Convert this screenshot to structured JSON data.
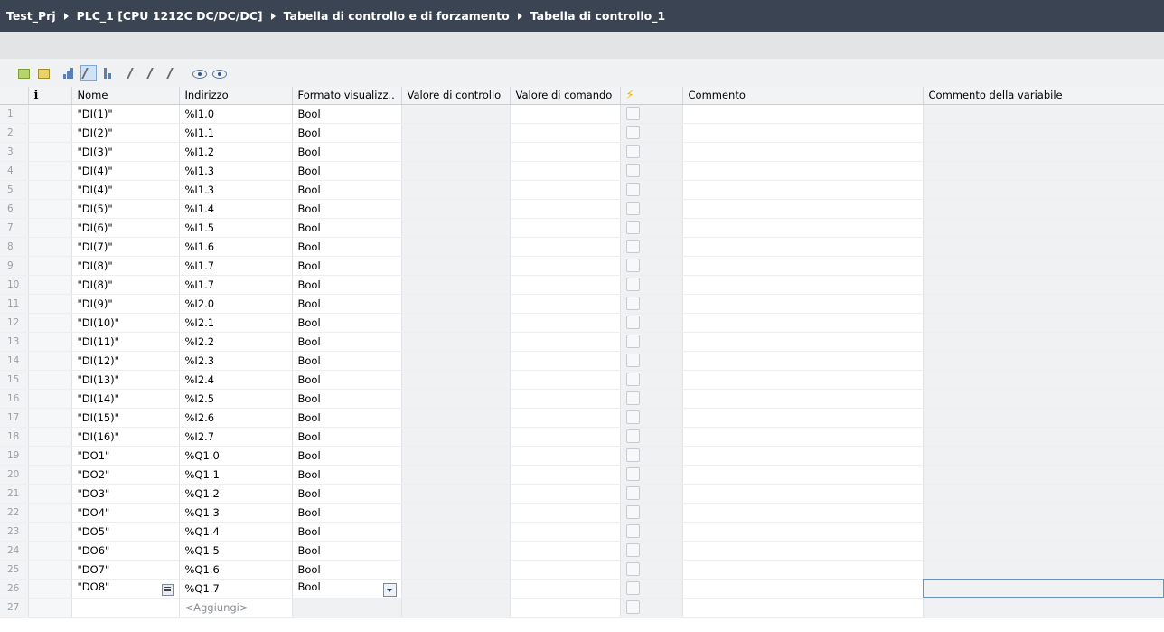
{
  "breadcrumb": {
    "items": [
      "Test_Prj",
      "PLC_1 [CPU 1212C DC/DC/DC]",
      "Tabella di controllo e di forzamento",
      "Tabella di controllo_1"
    ]
  },
  "toolbar": {
    "icons": [
      "insert-row-icon",
      "add-row-icon",
      "show-extended-icon",
      "show-all-modify-columns-icon",
      "show-trigger-columns-icon",
      "modify-now-icon",
      "modify-with-trigger-icon",
      "enable-peripheral-outputs-icon",
      "monitor-all-icon",
      "monitor-once-icon"
    ]
  },
  "table": {
    "columns": {
      "info": "i",
      "name": "Nome",
      "address": "Indirizzo",
      "format": "Formato visualizz..",
      "monitor": "Valore di controllo",
      "modify": "Valore di comando",
      "force": "⚡",
      "comment": "Commento",
      "tag_comment": "Commento della variabile"
    },
    "rows": [
      {
        "n": "1",
        "name": "\"DI(1)\"",
        "address": "%I1.0",
        "format": "Bool"
      },
      {
        "n": "2",
        "name": "\"DI(2)\"",
        "address": "%I1.1",
        "format": "Bool"
      },
      {
        "n": "3",
        "name": "\"DI(3)\"",
        "address": "%I1.2",
        "format": "Bool"
      },
      {
        "n": "4",
        "name": "\"DI(4)\"",
        "address": "%I1.3",
        "format": "Bool"
      },
      {
        "n": "5",
        "name": "\"DI(4)\"",
        "address": "%I1.3",
        "format": "Bool"
      },
      {
        "n": "6",
        "name": "\"DI(5)\"",
        "address": "%I1.4",
        "format": "Bool"
      },
      {
        "n": "7",
        "name": "\"DI(6)\"",
        "address": "%I1.5",
        "format": "Bool"
      },
      {
        "n": "8",
        "name": "\"DI(7)\"",
        "address": "%I1.6",
        "format": "Bool"
      },
      {
        "n": "9",
        "name": "\"DI(8)\"",
        "address": "%I1.7",
        "format": "Bool"
      },
      {
        "n": "10",
        "name": "\"DI(8)\"",
        "address": "%I1.7",
        "format": "Bool"
      },
      {
        "n": "11",
        "name": "\"DI(9)\"",
        "address": "%I2.0",
        "format": "Bool"
      },
      {
        "n": "12",
        "name": "\"DI(10)\"",
        "address": "%I2.1",
        "format": "Bool"
      },
      {
        "n": "13",
        "name": "\"DI(11)\"",
        "address": "%I2.2",
        "format": "Bool"
      },
      {
        "n": "14",
        "name": "\"DI(12)\"",
        "address": "%I2.3",
        "format": "Bool"
      },
      {
        "n": "15",
        "name": "\"DI(13)\"",
        "address": "%I2.4",
        "format": "Bool"
      },
      {
        "n": "16",
        "name": "\"DI(14)\"",
        "address": "%I2.5",
        "format": "Bool"
      },
      {
        "n": "17",
        "name": "\"DI(15)\"",
        "address": "%I2.6",
        "format": "Bool"
      },
      {
        "n": "18",
        "name": "\"DI(16)\"",
        "address": "%I2.7",
        "format": "Bool"
      },
      {
        "n": "19",
        "name": "\"DO1\"",
        "address": "%Q1.0",
        "format": "Bool"
      },
      {
        "n": "20",
        "name": "\"DO2\"",
        "address": "%Q1.1",
        "format": "Bool"
      },
      {
        "n": "21",
        "name": "\"DO3\"",
        "address": "%Q1.2",
        "format": "Bool"
      },
      {
        "n": "22",
        "name": "\"DO4\"",
        "address": "%Q1.3",
        "format": "Bool"
      },
      {
        "n": "23",
        "name": "\"DO5\"",
        "address": "%Q1.4",
        "format": "Bool"
      },
      {
        "n": "24",
        "name": "\"DO6\"",
        "address": "%Q1.5",
        "format": "Bool"
      },
      {
        "n": "25",
        "name": "\"DO7\"",
        "address": "%Q1.6",
        "format": "Bool"
      },
      {
        "n": "26",
        "name": "\"DO8\"",
        "address": "%Q1.7",
        "format": "Bool"
      }
    ],
    "add_row": {
      "n": "27",
      "placeholder": "<Aggiungi>"
    }
  },
  "colors": {
    "titlebar": "#3a4452",
    "selection": "#6a93c6",
    "force_icon": "#e7b600"
  }
}
